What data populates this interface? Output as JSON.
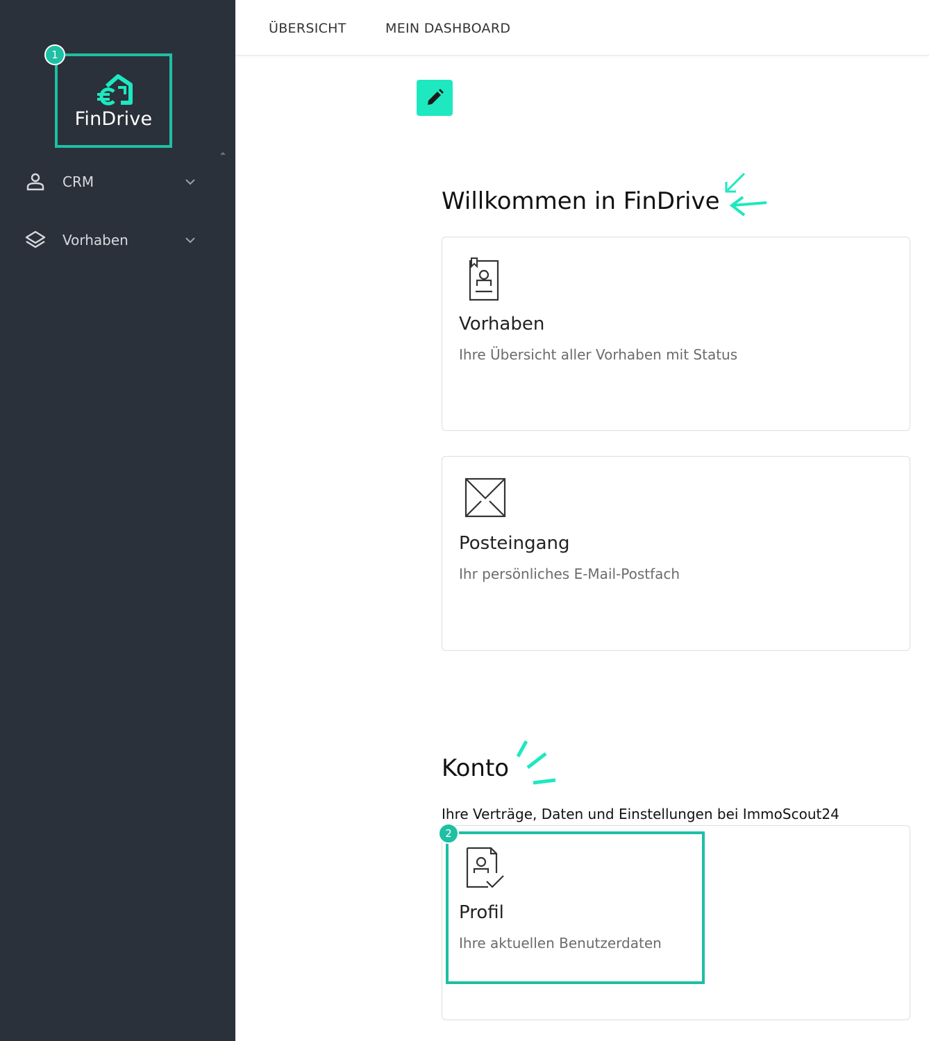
{
  "sidebar": {
    "logo_text": "FinDrive",
    "callout_1": "1",
    "items": [
      {
        "label": "CRM",
        "icon": "person-icon"
      },
      {
        "label": "Vorhaben",
        "icon": "layers-icon"
      }
    ]
  },
  "tabs": [
    {
      "label": "ÜBERSICHT"
    },
    {
      "label": "MEIN DASHBOARD"
    }
  ],
  "main": {
    "welcome_title": "Willkommen in FinDrive",
    "cards": [
      {
        "title": "Vorhaben",
        "desc": "Ihre Übersicht aller Vorhaben mit Status",
        "icon": "clipboard-person-icon"
      },
      {
        "title": "Posteingang",
        "desc": "Ihr persönliches E-Mail-Postfach",
        "icon": "envelope-icon"
      }
    ],
    "konto_title": "Konto",
    "konto_sub": "Ihre Verträge, Daten und Einstellungen bei ImmoScout24",
    "profile_card": {
      "title": "Profil",
      "desc": "Ihre aktuellen Benutzerdaten",
      "icon": "profile-doc-icon"
    },
    "callout_2": "2"
  },
  "colors": {
    "sidebar_bg": "#2b313a",
    "accent": "#1fbfa4",
    "edit_button": "#1ee8c0"
  }
}
